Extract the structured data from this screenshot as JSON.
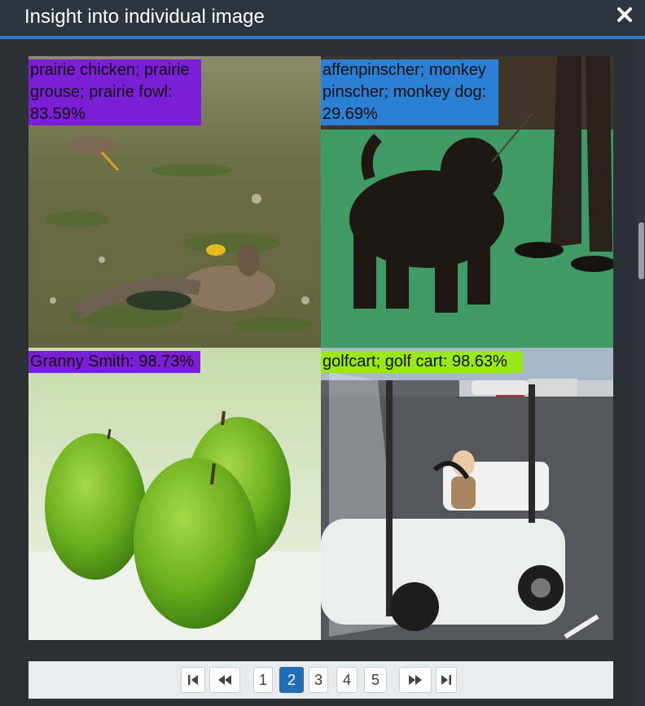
{
  "dialog": {
    "title": "Insight into individual image",
    "close_icon": "close-icon"
  },
  "predictions": [
    {
      "label": "prairie chicken; prairie grouse; prairie fowl: 83.59%",
      "label_color": "#7a1fd6",
      "image": "prairie-chicken-photo"
    },
    {
      "label": "affenpinscher; monkey pinscher; monkey dog: 29.69%",
      "label_color": "#2b7fd4",
      "image": "black-dog-photo"
    },
    {
      "label": "Granny Smith: 98.73%",
      "label_color": "#7a1fd6",
      "image": "green-apples-photo"
    },
    {
      "label": "golfcart; golf cart: 98.63%",
      "label_color": "#9be81a",
      "image": "golf-cart-photo"
    }
  ],
  "pagination": {
    "first_icon": "first-page-icon",
    "prev_icon": "previous-page-icon",
    "pages": [
      "1",
      "2",
      "3",
      "4",
      "5"
    ],
    "current": "2",
    "next_icon": "next-page-icon",
    "last_icon": "last-page-icon"
  }
}
